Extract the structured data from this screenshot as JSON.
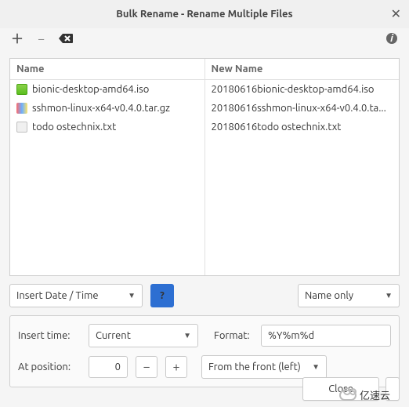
{
  "window": {
    "title": "Bulk Rename - Rename Multiple Files"
  },
  "columns": {
    "name": "Name",
    "newname": "New Name"
  },
  "files": [
    {
      "icon": "iso",
      "name": "bionic-desktop-amd64.iso",
      "newname": "20180616bionic-desktop-amd64.iso"
    },
    {
      "icon": "tar",
      "name": "sshmon-linux-x64-v0.4.0.tar.gz",
      "newname": "20180616sshmon-linux-x64-v0.4.0.ta..."
    },
    {
      "icon": "txt",
      "name": "todo ostechnix.txt",
      "newname": "20180616todo ostechnix.txt"
    }
  ],
  "operation": {
    "mode": "Insert Date / Time",
    "apply_to": "Name only"
  },
  "options": {
    "insert_time_label": "Insert time:",
    "insert_time_value": "Current",
    "format_label": "Format:",
    "format_value": "%Y%m%d",
    "position_label": "At position:",
    "position_value": "0",
    "from_value": "From the front (left)"
  },
  "buttons": {
    "close": "Close",
    "help": "?"
  },
  "watermark": "亿速云"
}
